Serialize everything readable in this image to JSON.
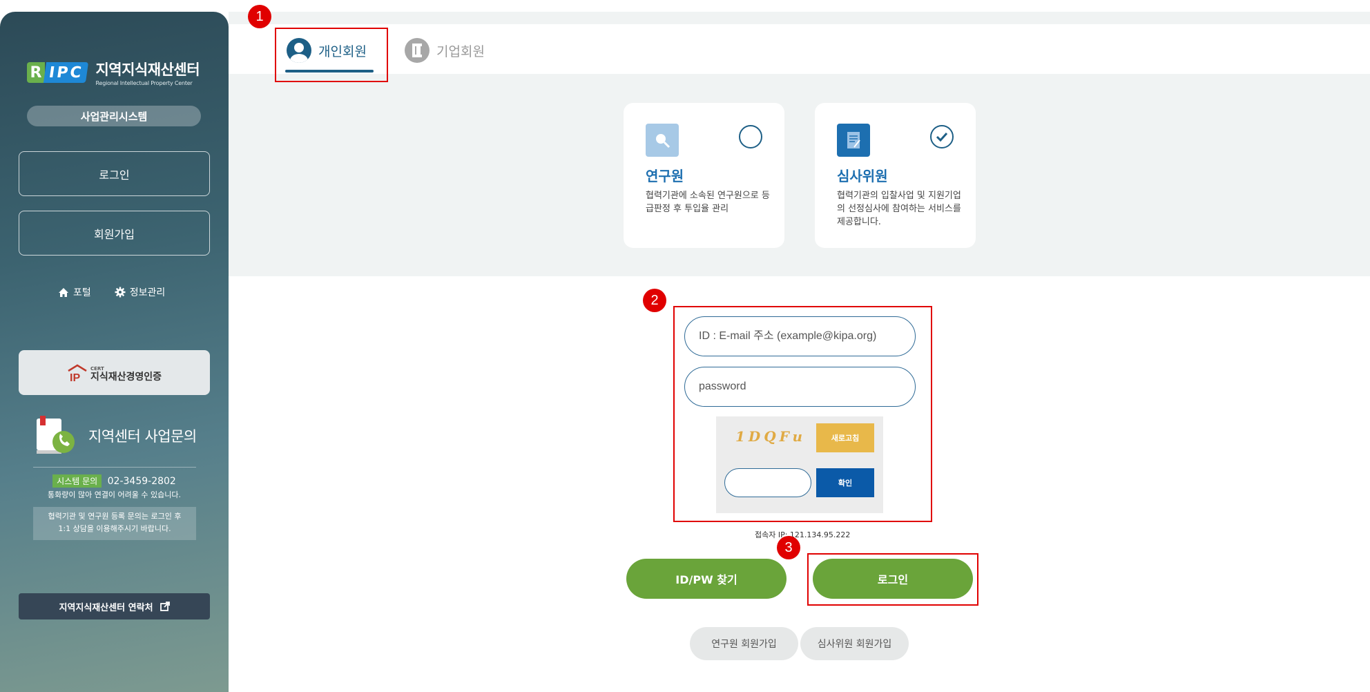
{
  "sidebar": {
    "logo_r": "R",
    "logo_ipc": "IPC",
    "logo_ko": "지역지식재산센터",
    "logo_en": "Regional Intellectual Property Center",
    "system_name": "사업관리시스템",
    "login": "로그인",
    "signup": "회원가입",
    "portal": "포털",
    "info_manage": "정보관리",
    "cert_small": "CERT",
    "cert_label": "지식재산경영인증",
    "inquiry_title": "지역센터 사업문의",
    "system_badge": "시스템 문의",
    "system_phone": "02-3459-2802",
    "busy_note": "통화량이 많아 연결이 어려울 수 있습니다.",
    "partner_note_1": "협력기관 및 연구원 등록 문의는 로그인 후",
    "partner_note_2": "1:1 상담을 이용해주시기 바랍니다.",
    "contact": "지역지식재산센터 연락처"
  },
  "tabs": {
    "personal": "개인회원",
    "corporate": "기업회원"
  },
  "roles": [
    {
      "title": "연구원",
      "desc": "협력기관에 소속된 연구원으로 등급판정 후 투입율 관리",
      "selected": false,
      "icon": "magnifier-icon",
      "icon_color": "#a7c9e6"
    },
    {
      "title": "심사위원",
      "desc": "협력기관의 입찰사업 및 지원기업의 선정심사에 참여하는 서비스를 제공합니다.",
      "selected": true,
      "icon": "document-icon",
      "icon_color": "#1d6fb0"
    }
  ],
  "login_form": {
    "id_placeholder": "ID : E-mail 주소 (example@kipa.org)",
    "password_placeholder": "password",
    "captcha_text": "1DQFu",
    "refresh": "새로고침",
    "confirm": "확인",
    "ip_label": "접속자 IP: 121.134.95.222"
  },
  "buttons": {
    "find": "ID/PW 찾기",
    "login": "로그인",
    "researcher_signup": "연구원 회원가입",
    "reviewer_signup": "심사위원 회원가입"
  },
  "annotations": [
    "1",
    "2",
    "3"
  ],
  "colors": {
    "accent_green": "#6aa43a",
    "accent_blue": "#1d5f86",
    "highlight_red": "#e00000"
  }
}
